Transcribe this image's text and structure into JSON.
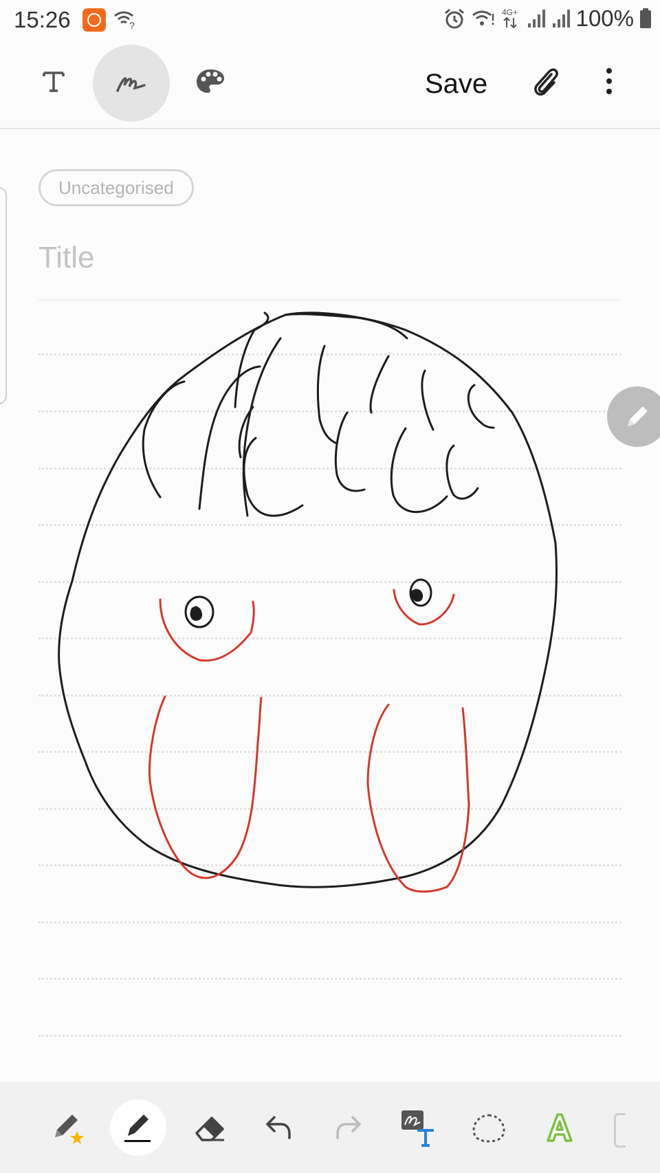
{
  "status_bar": {
    "time": "15:26",
    "battery": "100%",
    "icons": [
      "mi-app-icon",
      "wifi-question-icon",
      "alarm-icon",
      "wifi-icon",
      "4g-icon",
      "signal-icon",
      "signal-icon",
      "battery-icon"
    ]
  },
  "toolbar": {
    "save_label": "Save",
    "icons": [
      "text-mode-icon",
      "pen-mode-icon",
      "palette-icon",
      "attach-icon",
      "more-icon"
    ]
  },
  "note": {
    "category": "Uncategorised",
    "title_placeholder": "Title"
  },
  "drawing": {
    "stroke_colors": [
      "#1d1d1d",
      "#d2392b"
    ]
  },
  "bottom_toolbar": {
    "tools": [
      "favorite-pen-icon",
      "pen-icon",
      "eraser-icon",
      "undo-icon",
      "redo-icon",
      "handwriting-to-text-icon",
      "lasso-icon",
      "text-style-icon"
    ]
  },
  "colors": {
    "accent": "#2a7fdc",
    "green": "#7ac142",
    "star": "#f5b700"
  }
}
